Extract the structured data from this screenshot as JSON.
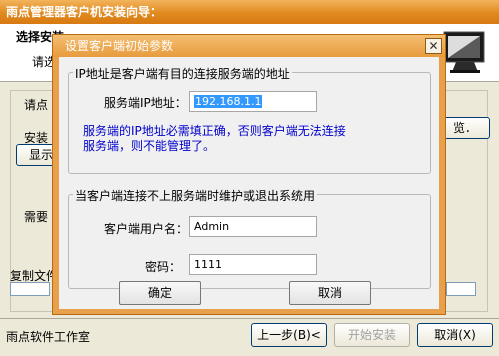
{
  "wizard": {
    "title": "雨点管理器客户机安装向导：",
    "step_title": "选择安装",
    "step_subtitle": "请选",
    "left_labels": {
      "please_click": "请点",
      "install_label": "安装",
      "show_button": "显示",
      "need_label": "需要",
      "copy_label": "复制文件"
    },
    "browse_button": "览．",
    "footer_brand": "雨点软件工作室",
    "buttons": {
      "back": "上一步(B)<",
      "start": "开始安装",
      "cancel": "取消(X)"
    }
  },
  "dialog": {
    "title": "设置客户端初始参数",
    "close_glyph": "✕",
    "ip_group": {
      "legend": "IP地址是客户端有目的连接服务端的地址",
      "server_ip_label": "服务端IP地址：",
      "server_ip_value": "192.168.1.1",
      "note": "服务端的IP地址必需填正确，否则客户端无法连接服务端，则不能管理了。"
    },
    "auth_group": {
      "legend": "当客户端连接不上服务端时维护或退出系统用",
      "username_label": "客户端用户名：",
      "username_value": "Admin",
      "password_label": "密码：",
      "password_value": "1111"
    },
    "ok_label": "确定",
    "cancel_label": "取消"
  }
}
